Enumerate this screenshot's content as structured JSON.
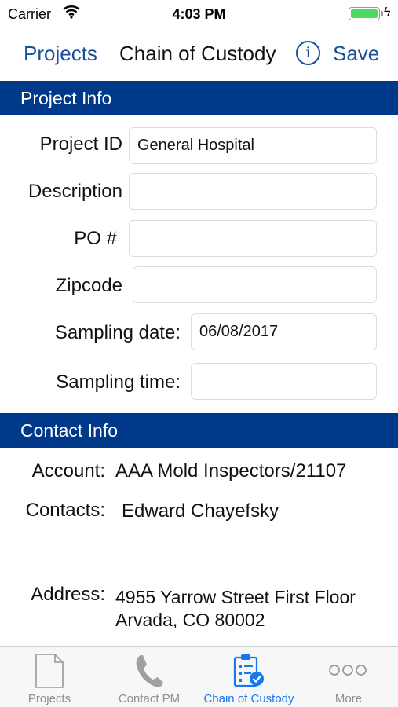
{
  "status_bar": {
    "carrier": "Carrier",
    "time": "4:03 PM"
  },
  "nav": {
    "back_label": "Projects",
    "title": "Chain of Custody",
    "save_label": "Save"
  },
  "project_info": {
    "header": "Project Info",
    "fields": [
      {
        "label": "Project ID",
        "value": "General Hospital"
      },
      {
        "label": "Description",
        "value": ""
      },
      {
        "label": "PO #",
        "value": ""
      },
      {
        "label": "Zipcode",
        "value": ""
      },
      {
        "label": "Sampling date:",
        "value": "06/08/2017"
      },
      {
        "label": "Sampling time:",
        "value": ""
      }
    ]
  },
  "contact_info": {
    "header": "Contact Info",
    "account_label": "Account:",
    "account_value": "AAA Mold Inspectors/21107",
    "contacts_label": "Contacts:",
    "contacts_value": "Edward Chayefsky",
    "address_label": "Address:",
    "address_line1": "4955 Yarrow Street First Floor",
    "address_line2": "Arvada, CO  80002"
  },
  "tab_bar": {
    "tabs": [
      {
        "label": "Projects",
        "icon": "document-icon",
        "active": false
      },
      {
        "label": "Contact PM",
        "icon": "phone-icon",
        "active": false
      },
      {
        "label": "Chain of Custody",
        "icon": "clipboard-check-icon",
        "active": true
      },
      {
        "label": "More",
        "icon": "more-icon",
        "active": false
      }
    ]
  },
  "colors": {
    "accent": "#1a4f9c",
    "section_header": "#00388a",
    "active_tab": "#1478f0",
    "inactive_tab": "#8e8e93",
    "battery": "#4cd964"
  }
}
